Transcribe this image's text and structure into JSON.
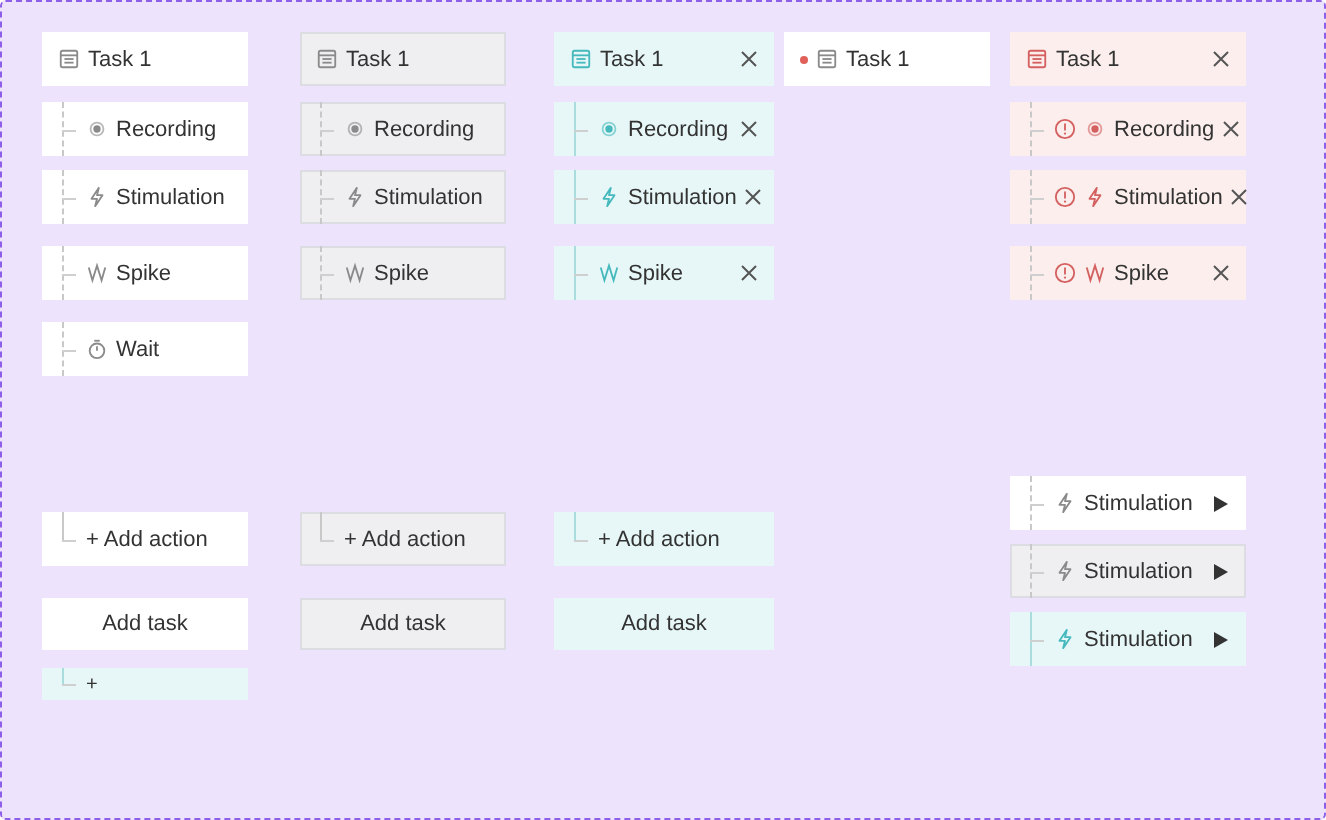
{
  "columns": [
    {
      "task": {
        "label": "Task 1",
        "hovered": false,
        "selected": false,
        "error": false,
        "closable": false,
        "modified": false
      },
      "actions": [
        {
          "kind": "recording",
          "label": "Recording",
          "hovered": false,
          "selected": false,
          "error": false,
          "closable": false
        },
        {
          "kind": "stimulation",
          "label": "Stimulation",
          "hovered": false,
          "selected": false,
          "error": false,
          "closable": false
        },
        {
          "kind": "spike",
          "label": "Spike",
          "hovered": false,
          "selected": false,
          "error": false,
          "closable": false
        },
        {
          "kind": "wait",
          "label": "Wait",
          "hovered": false,
          "selected": false,
          "error": false,
          "closable": false
        }
      ]
    },
    {
      "task": {
        "label": "Task 1",
        "hovered": true,
        "selected": false,
        "error": false,
        "closable": false,
        "modified": false
      },
      "actions": [
        {
          "kind": "recording",
          "label": "Recording",
          "hovered": true,
          "selected": false,
          "error": false,
          "closable": false
        },
        {
          "kind": "stimulation",
          "label": "Stimulation",
          "hovered": true,
          "selected": false,
          "error": false,
          "closable": false
        },
        {
          "kind": "spike",
          "label": "Spike",
          "hovered": true,
          "selected": false,
          "error": false,
          "closable": false
        }
      ]
    },
    {
      "task": {
        "label": "Task 1",
        "hovered": false,
        "selected": true,
        "error": false,
        "closable": true,
        "modified": false
      },
      "actions": [
        {
          "kind": "recording",
          "label": "Recording",
          "hovered": false,
          "selected": true,
          "error": false,
          "closable": true
        },
        {
          "kind": "stimulation",
          "label": "Stimulation",
          "hovered": false,
          "selected": true,
          "error": false,
          "closable": true
        },
        {
          "kind": "spike",
          "label": "Spike",
          "hovered": false,
          "selected": true,
          "error": false,
          "closable": true
        }
      ]
    },
    {
      "task": {
        "label": "Task 1",
        "hovered": false,
        "selected": false,
        "error": false,
        "closable": false,
        "modified": true
      }
    },
    {
      "task": {
        "label": "Task 1",
        "hovered": false,
        "selected": false,
        "error": true,
        "closable": true,
        "modified": false
      },
      "actions": [
        {
          "kind": "recording",
          "label": "Recording",
          "hovered": false,
          "selected": false,
          "error": true,
          "closable": true
        },
        {
          "kind": "stimulation",
          "label": "Stimulation",
          "hovered": false,
          "selected": false,
          "error": true,
          "closable": true
        },
        {
          "kind": "spike",
          "label": "Spike",
          "hovered": false,
          "selected": false,
          "error": true,
          "closable": true
        }
      ]
    }
  ],
  "add_columns": [
    {
      "add_action": {
        "label": "+ Add action",
        "hovered": false,
        "selected": false
      },
      "add_task": {
        "label": "Add task",
        "hovered": false,
        "selected": false
      },
      "add_blank": {
        "label": "+",
        "hovered": false,
        "selected": true
      }
    },
    {
      "add_action": {
        "label": "+ Add action",
        "hovered": true,
        "selected": false
      },
      "add_task": {
        "label": "Add task",
        "hovered": true,
        "selected": false
      }
    },
    {
      "add_action": {
        "label": "+ Add action",
        "hovered": false,
        "selected": true
      },
      "add_task": {
        "label": "Add task",
        "hovered": false,
        "selected": true
      }
    }
  ],
  "run_actions": [
    {
      "kind": "stimulation",
      "label": "Stimulation",
      "hovered": false,
      "selected": false
    },
    {
      "kind": "stimulation",
      "label": "Stimulation",
      "hovered": true,
      "selected": false
    },
    {
      "kind": "stimulation",
      "label": "Stimulation",
      "hovered": false,
      "selected": true
    }
  ]
}
